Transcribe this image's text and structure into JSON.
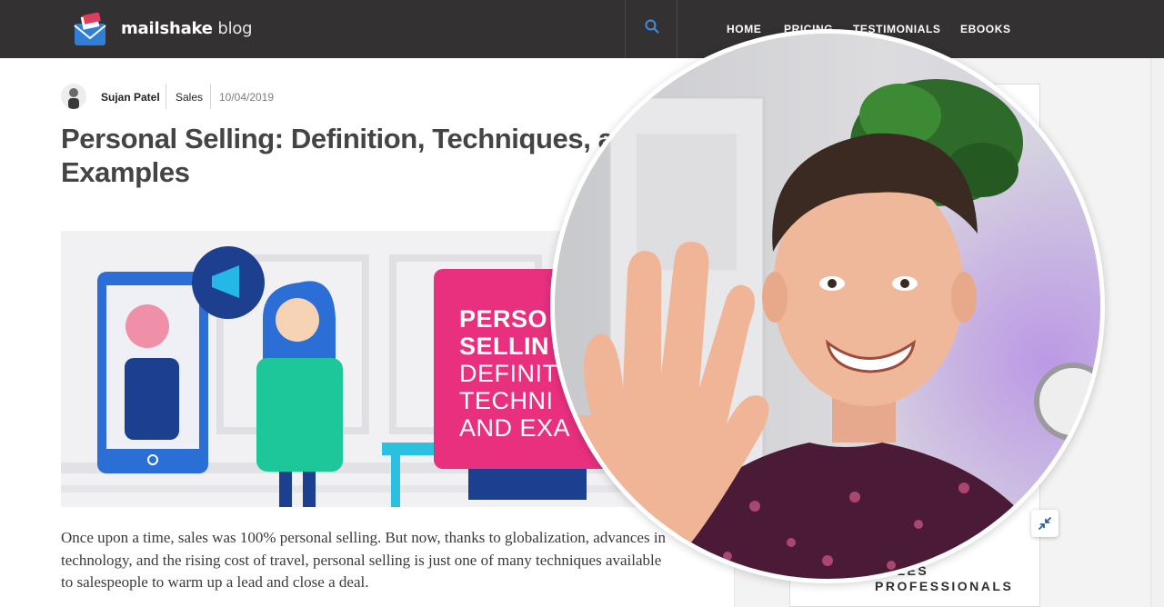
{
  "header": {
    "brand_bold": "mailshake",
    "brand_light": "blog",
    "search_icon": "search-icon",
    "nav": [
      {
        "label": "HOME"
      },
      {
        "label": "PRICING"
      },
      {
        "label": "TESTIMONIALS"
      },
      {
        "label": "EBOOKS"
      }
    ],
    "background_color": "#333132"
  },
  "post": {
    "author": "Sujan Patel",
    "category": "Sales",
    "date": "10/04/2019",
    "title_line1": "Personal Selling: Definition, Techniques, and",
    "title_line2": "Examples",
    "hero": {
      "lines": [
        "PERSO",
        "SELLIN",
        "DEFINIT",
        "TECHNI",
        "AND EXA"
      ],
      "accent_color": "#e8307e"
    },
    "body_lines": [
      "Once upon a time, sales was 100% personal selling. But now, thanks to globalization, advances in",
      "technology, and the rising cost of travel, personal selling is just one of many techniques available",
      "to salespeople to warm up a lead and close a deal."
    ]
  },
  "sidebar": {
    "caption_line1": "SALES",
    "caption_line2": "PROFESSIONALS"
  },
  "video_overlay": {
    "minimize_icon": "minimize-icon"
  }
}
